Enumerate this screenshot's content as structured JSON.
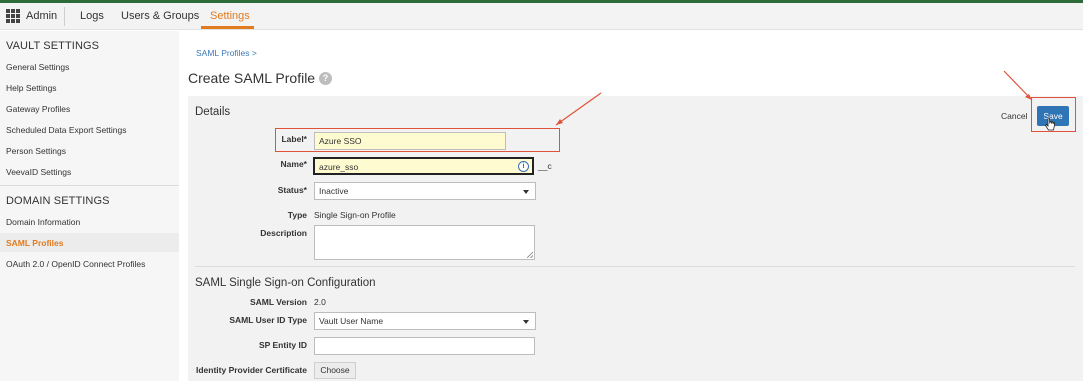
{
  "topnav": {
    "admin": "Admin",
    "logs": "Logs",
    "users_groups": "Users & Groups",
    "settings": "Settings"
  },
  "sidebar": {
    "vault_settings_title": "VAULT SETTINGS",
    "vault_items": [
      "General Settings",
      "Help Settings",
      "Gateway Profiles",
      "Scheduled Data Export Settings",
      "Person Settings",
      "VeevaID Settings"
    ],
    "domain_settings_title": "DOMAIN SETTINGS",
    "domain_items": [
      "Domain Information",
      "SAML Profiles",
      "OAuth 2.0 / OpenID Connect Profiles"
    ]
  },
  "breadcrumb": "SAML Profiles >",
  "page_title": "Create SAML Profile",
  "help_icon_glyph": "?",
  "details": {
    "title": "Details",
    "cancel": "Cancel",
    "save": "Save",
    "label_label": "Label*",
    "label_value": "Azure SSO",
    "name_label": "Name*",
    "name_value": "azure_sso",
    "name_suffix": "__c",
    "status_label": "Status*",
    "status_value": "Inactive",
    "type_label": "Type",
    "type_value": "Single Sign-on Profile",
    "description_label": "Description"
  },
  "saml": {
    "title": "SAML Single Sign-on Configuration",
    "version_label": "SAML Version",
    "version_value": "2.0",
    "user_id_type_label": "SAML User ID Type",
    "user_id_type_value": "Vault User Name",
    "sp_entity_label": "SP Entity ID",
    "idp_cert_label": "Identity Provider Certificate",
    "choose": "Choose"
  },
  "colors": {
    "accent": "#e07b1f",
    "primary_button": "#2f74b5",
    "annotation_red": "#e0533a",
    "highlight_input": "#fffbd0"
  }
}
